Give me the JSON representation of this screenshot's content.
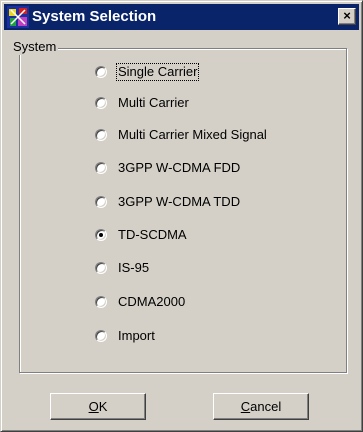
{
  "window": {
    "title": "System Selection",
    "close_glyph": "×"
  },
  "icons": {
    "app": "app-logo-icon",
    "close": "close-icon"
  },
  "group": {
    "label": "System"
  },
  "options": [
    {
      "label": "Single Carrier",
      "checked": false
    },
    {
      "label": "Multi Carrier",
      "checked": false
    },
    {
      "label": "Multi Carrier Mixed Signal",
      "checked": false
    },
    {
      "label": "3GPP W-CDMA FDD",
      "checked": false
    },
    {
      "label": "3GPP W-CDMA TDD",
      "checked": false
    },
    {
      "label": "TD-SCDMA",
      "checked": true
    },
    {
      "label": "IS-95",
      "checked": false
    },
    {
      "label": "CDMA2000",
      "checked": false
    },
    {
      "label": "Import",
      "checked": false
    }
  ],
  "buttons": {
    "ok_mnemonic": "O",
    "ok_rest": "K",
    "cancel_mnemonic": "C",
    "cancel_rest": "ancel"
  }
}
